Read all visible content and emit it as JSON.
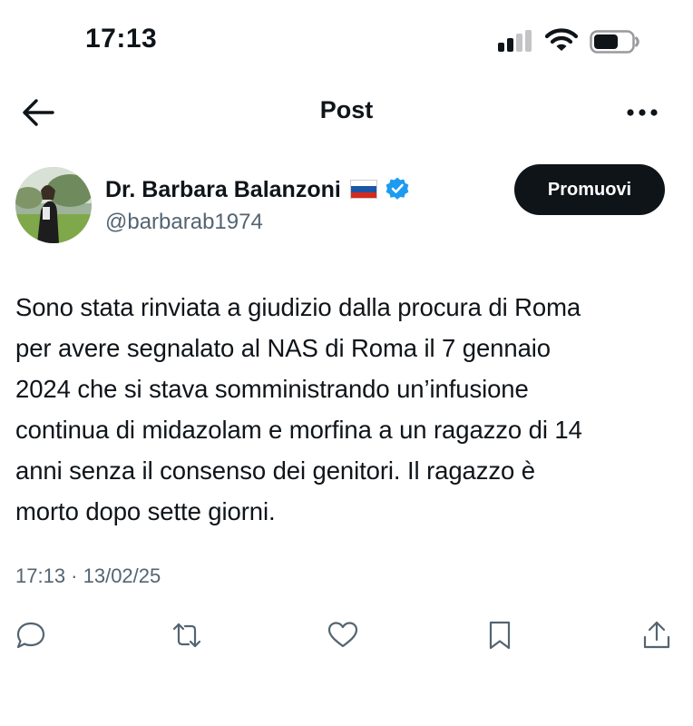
{
  "status_bar": {
    "time": "17:13",
    "signal_icon": "signal-icon",
    "wifi_icon": "wifi-icon",
    "battery_icon": "battery-icon"
  },
  "header": {
    "title": "Post",
    "back_icon": "arrow-left-icon",
    "more_icon": "more-horizontal-icon"
  },
  "author": {
    "name": "Dr. Barbara Balanzoni",
    "flag_icon": "russia-flag-icon",
    "verified_icon": "verified-badge-icon",
    "handle": "@barbarab1974",
    "promote_label": "Promuovi"
  },
  "tweet": {
    "text": "Sono stata rinviata a giudizio dalla procura di Roma\nper avere segnalato al NAS di Roma il 7 gennaio\n2024 che si stava somministrando un’infusione\ncontinua di midazolam e morfina a un ragazzo di 14\nanni senza il consenso dei genitori. Il ragazzo è\nmorto dopo sette giorni.",
    "timestamp": "17:13 · 13/02/25"
  },
  "actions": [
    {
      "name": "reply",
      "icon": "reply-icon"
    },
    {
      "name": "repost",
      "icon": "repost-icon"
    },
    {
      "name": "like",
      "icon": "heart-icon"
    },
    {
      "name": "bookmark",
      "icon": "bookmark-icon"
    },
    {
      "name": "share",
      "icon": "share-icon"
    }
  ],
  "colors": {
    "text": "#0f1419",
    "secondary": "#536471",
    "verified": "#1d9bf0",
    "button_bg": "#0f1419"
  }
}
